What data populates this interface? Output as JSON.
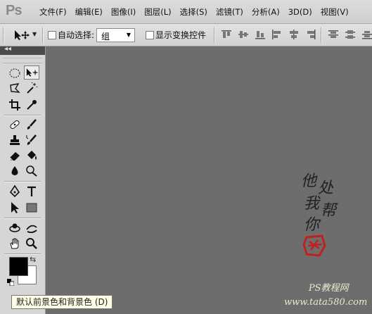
{
  "app": {
    "logo": "Ps"
  },
  "menu": [
    "文件(F)",
    "编辑(E)",
    "图像(I)",
    "图层(L)",
    "选择(S)",
    "滤镜(T)",
    "分析(A)",
    "3D(D)",
    "视图(V)"
  ],
  "options": {
    "auto_select_label": "自动选择:",
    "auto_select_value": "组",
    "show_transform_label": "显示变换控件"
  },
  "toolbox": {
    "collapse_glyph": "◂◂"
  },
  "colors": {
    "foreground": "#000000",
    "background": "#ffffff",
    "canvas": "#6d6d6d"
  },
  "tooltip": "默认前景色和背景色 (D)",
  "watermark": {
    "calligraphy": [
      "他",
      "处",
      "我",
      "帮",
      "你"
    ],
    "site_name": "PS教程网",
    "site_url": "www.tata580.com"
  }
}
